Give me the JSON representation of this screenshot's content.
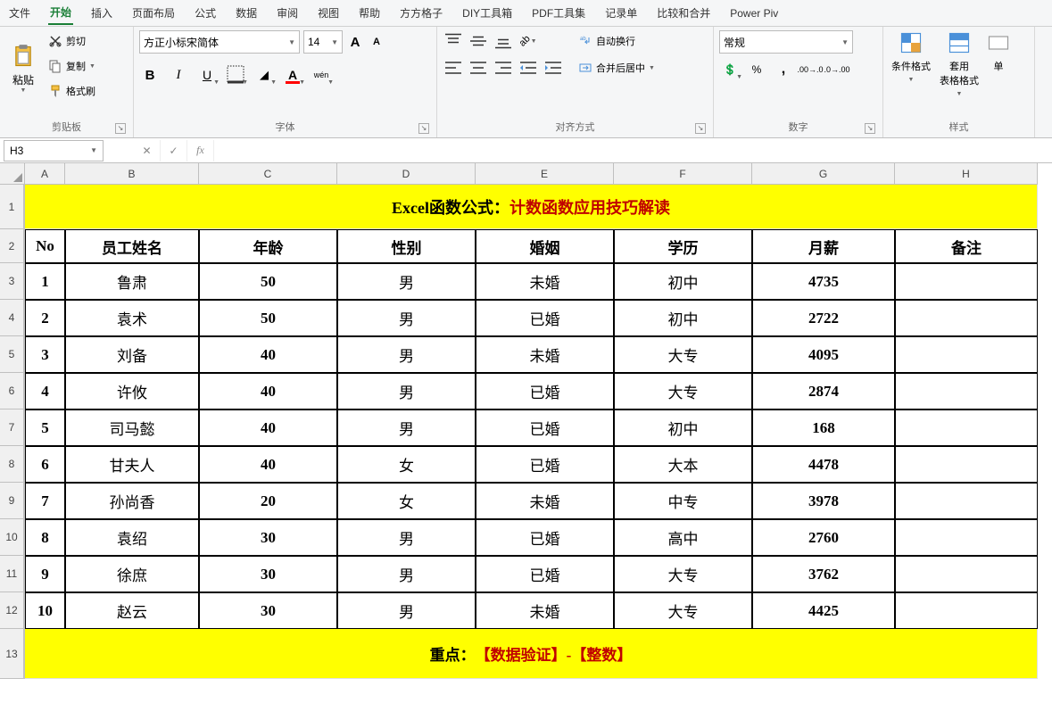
{
  "menu": {
    "items": [
      "文件",
      "开始",
      "插入",
      "页面布局",
      "公式",
      "数据",
      "审阅",
      "视图",
      "帮助",
      "方方格子",
      "DIY工具箱",
      "PDF工具集",
      "记录单",
      "比较和合并",
      "Power Piv"
    ],
    "active_index": 1
  },
  "ribbon": {
    "clipboard": {
      "label": "剪贴板",
      "paste": "粘贴",
      "cut": "剪切",
      "copy": "复制",
      "format_painter": "格式刷"
    },
    "font": {
      "label": "字体",
      "name": "方正小标宋简体",
      "size": "14",
      "size_up": "A",
      "size_down": "A",
      "bold": "B",
      "italic": "I",
      "underline": "U",
      "pinyin": "wén",
      "fill_color": "#ffff00",
      "font_color": "#ff0000"
    },
    "alignment": {
      "label": "对齐方式",
      "wrap": "自动换行",
      "merge": "合并后居中"
    },
    "number": {
      "label": "数字",
      "format": "常规"
    },
    "styles": {
      "label": "样式",
      "cond_format": "条件格式",
      "table_format": "套用\n表格格式",
      "cell": "单"
    }
  },
  "formula_bar": {
    "cell_ref": "H3",
    "fx": "fx",
    "formula": ""
  },
  "grid": {
    "cols": [
      "A",
      "B",
      "C",
      "D",
      "E",
      "F",
      "G",
      "H"
    ],
    "row_nums": [
      "1",
      "2",
      "3",
      "4",
      "5",
      "6",
      "7",
      "8",
      "9",
      "10",
      "11",
      "12",
      "13"
    ],
    "title": {
      "part1": "Excel函数公式：",
      "part2": "计数函数应用技巧解读"
    },
    "headers": [
      "No",
      "员工姓名",
      "年龄",
      "性别",
      "婚姻",
      "学历",
      "月薪",
      "备注"
    ],
    "data": [
      [
        "1",
        "鲁肃",
        "50",
        "男",
        "未婚",
        "初中",
        "4735",
        ""
      ],
      [
        "2",
        "袁术",
        "50",
        "男",
        "已婚",
        "初中",
        "2722",
        ""
      ],
      [
        "3",
        "刘备",
        "40",
        "男",
        "未婚",
        "大专",
        "4095",
        ""
      ],
      [
        "4",
        "许攸",
        "40",
        "男",
        "已婚",
        "大专",
        "2874",
        ""
      ],
      [
        "5",
        "司马懿",
        "40",
        "男",
        "已婚",
        "初中",
        "168",
        ""
      ],
      [
        "6",
        "甘夫人",
        "40",
        "女",
        "已婚",
        "大本",
        "4478",
        ""
      ],
      [
        "7",
        "孙尚香",
        "20",
        "女",
        "未婚",
        "中专",
        "3978",
        ""
      ],
      [
        "8",
        "袁绍",
        "30",
        "男",
        "已婚",
        "高中",
        "2760",
        ""
      ],
      [
        "9",
        "徐庶",
        "30",
        "男",
        "已婚",
        "大专",
        "3762",
        ""
      ],
      [
        "10",
        "赵云",
        "30",
        "男",
        "未婚",
        "大专",
        "4425",
        ""
      ]
    ],
    "footer": {
      "part1": "重点：",
      "part2": "【数据验证】-【整数】"
    }
  },
  "chart_data": {
    "type": "table",
    "title": "Excel函数公式：计数函数应用技巧解读",
    "columns": [
      "No",
      "员工姓名",
      "年龄",
      "性别",
      "婚姻",
      "学历",
      "月薪",
      "备注"
    ],
    "rows": [
      {
        "No": 1,
        "员工姓名": "鲁肃",
        "年龄": 50,
        "性别": "男",
        "婚姻": "未婚",
        "学历": "初中",
        "月薪": 4735,
        "备注": ""
      },
      {
        "No": 2,
        "员工姓名": "袁术",
        "年龄": 50,
        "性别": "男",
        "婚姻": "已婚",
        "学历": "初中",
        "月薪": 2722,
        "备注": ""
      },
      {
        "No": 3,
        "员工姓名": "刘备",
        "年龄": 40,
        "性别": "男",
        "婚姻": "未婚",
        "学历": "大专",
        "月薪": 4095,
        "备注": ""
      },
      {
        "No": 4,
        "员工姓名": "许攸",
        "年龄": 40,
        "性别": "男",
        "婚姻": "已婚",
        "学历": "大专",
        "月薪": 2874,
        "备注": ""
      },
      {
        "No": 5,
        "员工姓名": "司马懿",
        "年龄": 40,
        "性别": "男",
        "婚姻": "已婚",
        "学历": "初中",
        "月薪": 168,
        "备注": ""
      },
      {
        "No": 6,
        "员工姓名": "甘夫人",
        "年龄": 40,
        "性别": "女",
        "婚姻": "已婚",
        "学历": "大本",
        "月薪": 4478,
        "备注": ""
      },
      {
        "No": 7,
        "员工姓名": "孙尚香",
        "年龄": 20,
        "性别": "女",
        "婚姻": "未婚",
        "学历": "中专",
        "月薪": 3978,
        "备注": ""
      },
      {
        "No": 8,
        "员工姓名": "袁绍",
        "年龄": 30,
        "性别": "男",
        "婚姻": "已婚",
        "学历": "高中",
        "月薪": 2760,
        "备注": ""
      },
      {
        "No": 9,
        "员工姓名": "徐庶",
        "年龄": 30,
        "性别": "男",
        "婚姻": "已婚",
        "学历": "大专",
        "月薪": 3762,
        "备注": ""
      },
      {
        "No": 10,
        "员工姓名": "赵云",
        "年龄": 30,
        "性别": "男",
        "婚姻": "未婚",
        "学历": "大专",
        "月薪": 4425,
        "备注": ""
      }
    ],
    "footer": "重点：【数据验证】-【整数】"
  }
}
